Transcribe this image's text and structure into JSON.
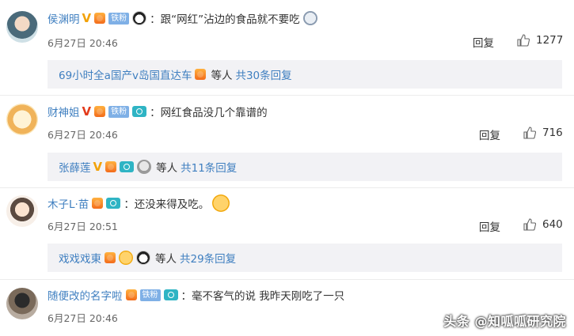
{
  "comments": [
    {
      "username": "侯渊明",
      "v_badge": "V",
      "fan_label": "铁粉",
      "text": "：跟“网红”沾边的食品就不要吃",
      "time": "6月27日 20:46",
      "reply_label": "回复",
      "likes": "1277",
      "sub": {
        "username": "69小时全a国产v岛国直达车",
        "mid": "等人",
        "count": "共30条回复"
      }
    },
    {
      "username": "财神姐",
      "v_badge": "V",
      "fan_label": "铁粉",
      "text": "：网红食品没几个靠谱的",
      "time": "6月27日 20:46",
      "reply_label": "回复",
      "likes": "716",
      "sub": {
        "username": "张薛莲",
        "v_badge": "V",
        "mid": "等人",
        "count": "共11条回复"
      }
    },
    {
      "username": "木子L·苗",
      "text": "：还没来得及吃。",
      "time": "6月27日 20:51",
      "reply_label": "回复",
      "likes": "640",
      "sub": {
        "username": "戏戏戏東",
        "mid": "等人",
        "count": "共29条回复"
      }
    },
    {
      "username": "随便改的名字啦",
      "fan_label": "铁粉",
      "text": "：毫不客气的说 我昨天刚吃了一只",
      "time": "6月27日 20:46"
    }
  ],
  "watermark": "头条 @知呱呱研究院",
  "icons": {
    "thumb": "thumbs-up-icon",
    "level": "level-badge-icon",
    "camera": "camera-badge-icon"
  }
}
